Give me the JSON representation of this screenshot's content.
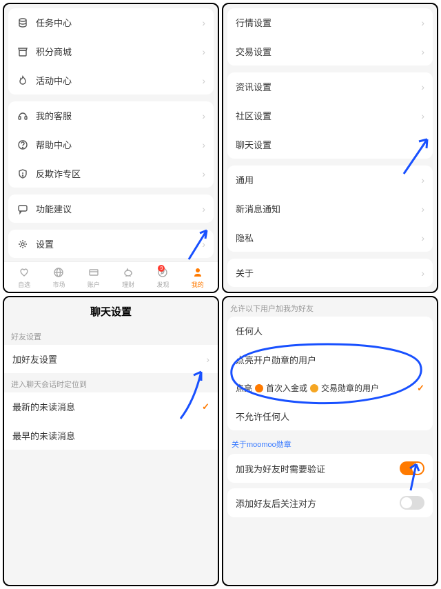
{
  "panel1": {
    "groups": [
      {
        "items": [
          {
            "icon": "stack",
            "label": "任务中心"
          },
          {
            "icon": "store",
            "label": "积分商城"
          },
          {
            "icon": "flame",
            "label": "活动中心"
          }
        ]
      },
      {
        "items": [
          {
            "icon": "headset",
            "label": "我的客服"
          },
          {
            "icon": "help",
            "label": "帮助中心"
          },
          {
            "icon": "shield",
            "label": "反欺诈专区"
          }
        ]
      },
      {
        "items": [
          {
            "icon": "comment",
            "label": "功能建议"
          }
        ]
      },
      {
        "items": [
          {
            "icon": "gear",
            "label": "设置"
          }
        ]
      }
    ],
    "tabs": [
      {
        "icon": "heart",
        "label": "自选"
      },
      {
        "icon": "globe",
        "label": "市场"
      },
      {
        "icon": "card",
        "label": "账户"
      },
      {
        "icon": "pig",
        "label": "理财"
      },
      {
        "icon": "compass",
        "label": "发现",
        "badge": "9"
      },
      {
        "icon": "person",
        "label": "我的",
        "active": true
      }
    ]
  },
  "panel2": {
    "groups": [
      {
        "items": [
          {
            "label": "行情设置"
          },
          {
            "label": "交易设置"
          }
        ]
      },
      {
        "items": [
          {
            "label": "资讯设置"
          },
          {
            "label": "社区设置"
          },
          {
            "label": "聊天设置"
          }
        ]
      },
      {
        "items": [
          {
            "label": "通用"
          },
          {
            "label": "新消息通知"
          },
          {
            "label": "隐私"
          }
        ]
      },
      {
        "items": [
          {
            "label": "关于"
          }
        ]
      }
    ]
  },
  "panel3": {
    "title": "聊天设置",
    "section1_label": "好友设置",
    "section1_items": [
      {
        "label": "加好友设置"
      }
    ],
    "section2_label": "进入聊天会话时定位到",
    "section2_items": [
      {
        "label": "最新的未读消息",
        "checked": true
      },
      {
        "label": "最早的未读消息",
        "checked": false
      }
    ]
  },
  "panel4": {
    "section_label": "允许以下用户加我为好友",
    "options": [
      {
        "label": "任何人"
      },
      {
        "label": "点亮开户勋章的用户"
      },
      {
        "parts": [
          "点亮",
          "首次入金或",
          "交易勋章的用户"
        ],
        "checked": true,
        "badges": true
      },
      {
        "label": "不允许任何人"
      }
    ],
    "link": "关于moomoo勋章",
    "toggles": [
      {
        "label": "加我为好友时需要验证",
        "on": true
      },
      {
        "label": "添加好友后关注对方",
        "on": false
      }
    ]
  }
}
